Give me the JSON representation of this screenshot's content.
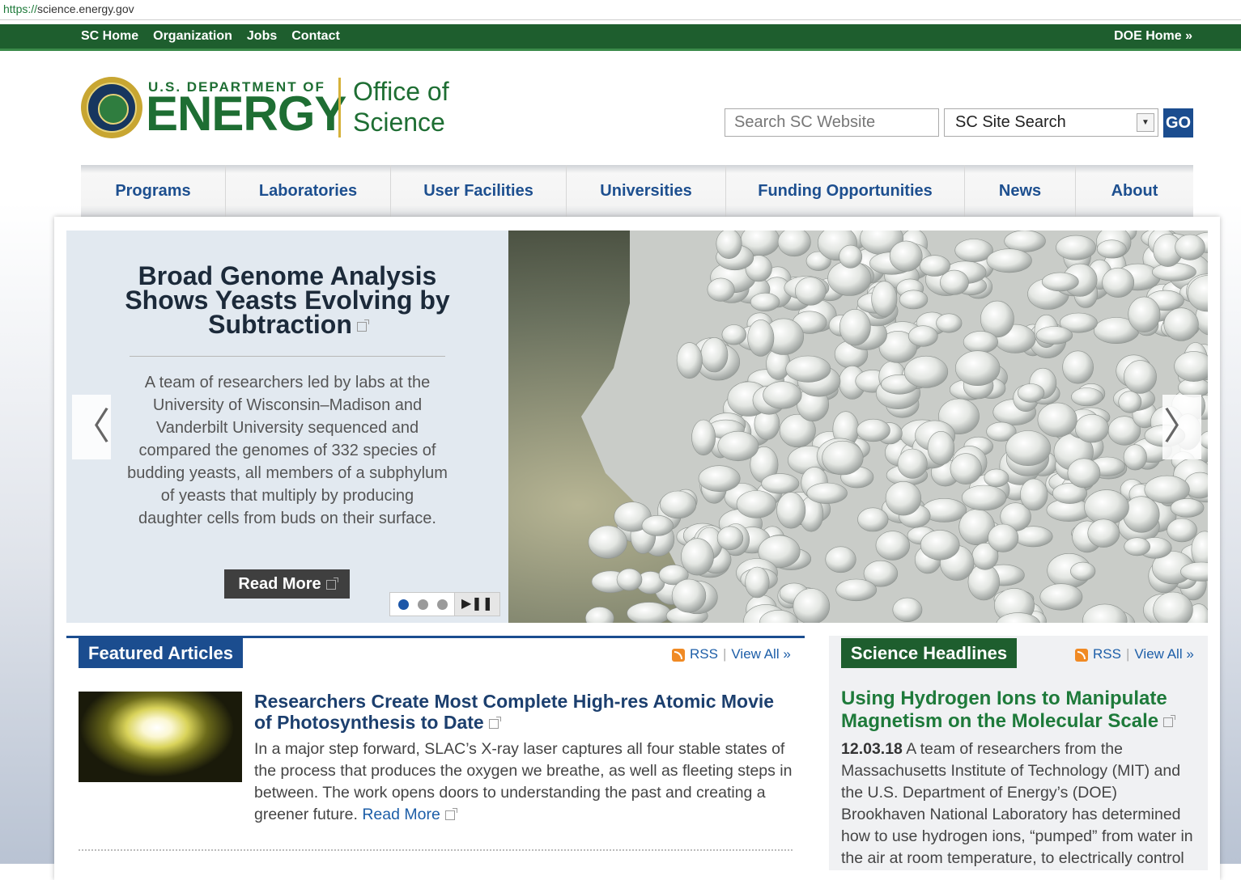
{
  "browser": {
    "url_scheme": "https://",
    "url_rest": "science.energy.gov"
  },
  "topbar": {
    "links": [
      "SC Home",
      "Organization",
      "Jobs",
      "Contact"
    ],
    "doe_home": "DOE Home »"
  },
  "header": {
    "doe_small": "U.S. DEPARTMENT OF",
    "energy": "ENERGY",
    "office_line1": "Office of",
    "office_line2": "Science"
  },
  "search": {
    "placeholder": "Search SC Website",
    "scope": "SC Site Search",
    "go": "GO"
  },
  "nav": [
    "Programs",
    "Laboratories",
    "User Facilities",
    "Universities",
    "Funding Opportunities",
    "News",
    "About"
  ],
  "slider": {
    "title": "Broad Genome Analysis Shows Yeasts Evolving by Subtraction",
    "body": "A team of researchers led by labs at the University of Wisconsin–Madison and Vanderbilt University sequenced and compared the genomes of 332 species of budding yeasts, all members of a subphylum of yeasts that multiply by producing daughter cells from buds on their surface.",
    "read_more": "Read More",
    "slide_count": 3,
    "active_slide": 1,
    "play_pause": "▶❚❚",
    "prev_arrow": "〈",
    "next_arrow": "〉"
  },
  "featured": {
    "heading": "Featured Articles",
    "rss": "RSS",
    "view_all": "View All »",
    "article": {
      "title": "Researchers Create Most Complete High-res Atomic Movie of Photosynthesis to Date",
      "body": "In a major step forward, SLAC’s X-ray laser captures all four stable states of the process that produces the oxygen we breathe, as well as fleeting steps in between. The work opens doors to understanding the past and creating a greener future.",
      "read_more": "Read More"
    }
  },
  "headlines": {
    "heading": "Science Headlines",
    "rss": "RSS",
    "view_all": "View All »",
    "item": {
      "title": "Using Hydrogen Ions to Manipulate Magnetism on the Molecular Scale",
      "date": "12.03.18",
      "body": "A team of researchers from the Massachusetts Institute of Technology (MIT) and the U.S. Department of Energy’s (DOE) Brookhaven National Laboratory has determined how to use hydrogen ions, “pumped” from water in the air at room temperature, to electrically control"
    }
  },
  "colors": {
    "doe_green": "#1e6e33",
    "topbar_green": "#1e5e2e",
    "link_blue": "#1d5ea8",
    "nav_blue": "#1d4f8f",
    "go_blue": "#1b4d8f"
  }
}
